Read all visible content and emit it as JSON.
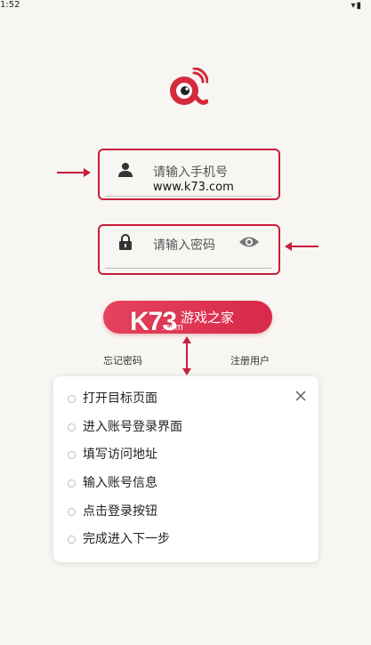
{
  "status_bar": {
    "time": "1:52",
    "icons": "▾▮"
  },
  "colors": {
    "accent": "#c81e3a",
    "button": "#e0354f"
  },
  "form": {
    "username_placeholder": "请输入手机号",
    "username_value": "www.k73.com",
    "password_placeholder": "请输入密码"
  },
  "login_button": {
    "label": "游戏之家"
  },
  "watermark": {
    "main": "K73",
    "sub": ".com"
  },
  "links": {
    "forgot": "忘记密码",
    "register": "注册用户"
  },
  "steps": {
    "items": [
      {
        "label": "打开目标页面"
      },
      {
        "label": "进入账号登录界面"
      },
      {
        "label": "填写访问地址"
      },
      {
        "label": "输入账号信息"
      },
      {
        "label": "点击登录按钮"
      },
      {
        "label": "完成进入下一步"
      }
    ]
  }
}
